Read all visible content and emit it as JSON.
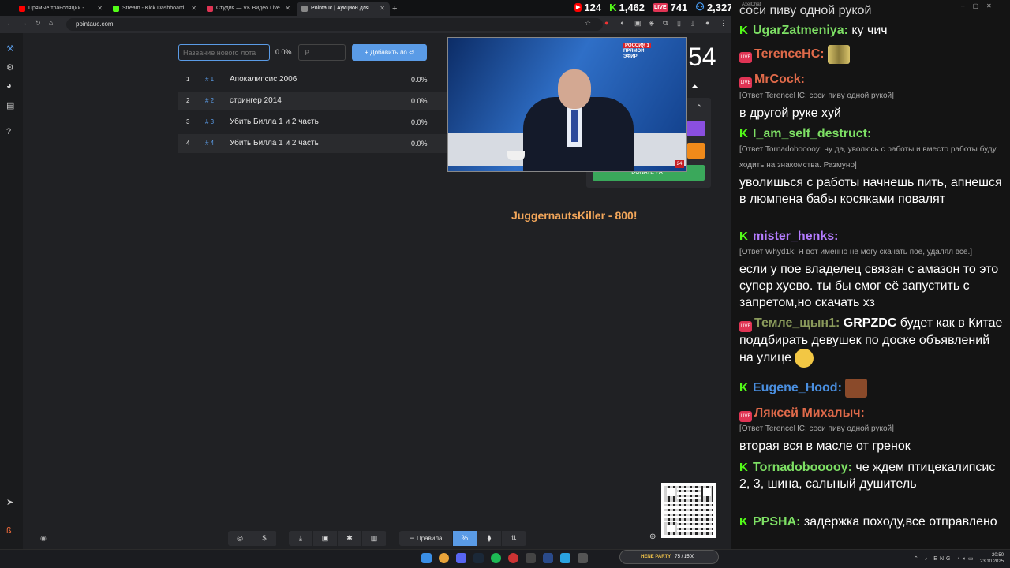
{
  "browser": {
    "tabs": [
      {
        "title": "Прямые трансляции - YouTube",
        "color": "#ff0000"
      },
      {
        "title": "Stream - Kick Dashboard",
        "color": "#53fc18"
      },
      {
        "title": "Студия — VK Видео Live",
        "color": "#e03454"
      },
      {
        "title": "Pointauc | Аукцион для стрим...",
        "color": "#888888"
      }
    ],
    "new_tab": "+",
    "url": "pointauc.com"
  },
  "stream_stats": {
    "youtube": "124",
    "kick": "1,462",
    "vk": "741",
    "total": "2,327",
    "vk_badge": "LIVE"
  },
  "auction": {
    "lot_placeholder": "Название нового лота",
    "percent": "0.0%",
    "amount_placeholder": "₽",
    "add_button": "Добавить ло",
    "lots": [
      {
        "num": "1",
        "hash": "# 1",
        "name": "Апокалипсис 2006",
        "pct": "0.0%"
      },
      {
        "num": "2",
        "hash": "# 2",
        "name": "стрингер 2014",
        "pct": "0.0%"
      },
      {
        "num": "3",
        "hash": "# 3",
        "name": "Убить Билла 1 и 2 часть",
        "pct": "0.0%"
      },
      {
        "num": "4",
        "hash": "# 4",
        "name": "Убить Билла 1 и 2 часть",
        "pct": "0.0%"
      }
    ],
    "timer_fragment": "54",
    "donate_pay": "DONATE PAY",
    "winner_text": "JuggernautsKiller - 800!",
    "bottom_rules": "Правила",
    "bottom_percent": "%"
  },
  "video": {
    "channel_logo": "РОССИЯ 1",
    "live_text": "ПРЯМОЙ ЭФИР",
    "badge": "24"
  },
  "chat": {
    "window_title": "AxelChat",
    "messages": [
      {
        "platform": "kick",
        "user": "UgarZatmeniya:",
        "color": "#7ddf64",
        "text": "ку чич"
      },
      {
        "platform": "vk",
        "user": "TerenceHC:",
        "color": "#e06a4a",
        "text": ""
      },
      {
        "platform": "vk",
        "user": "MrCock:",
        "color": "#e06a4a",
        "reply": "[Ответ TerenceHC: соси пиву одной рукой]",
        "text": "в другой руке хуй"
      },
      {
        "platform": "kick",
        "user": "I_am_self_destruct:",
        "color": "#7ddf64",
        "reply": "[Ответ Tornadobooooy: ну да, уволюсь с работы и вместо работы буду ходить на знакомства. Размуно]",
        "text": "уволишься с работы начнешь пить, апнешся в люмпена бабы косяками повалят"
      },
      {
        "platform": "kick",
        "user": "mister_henks:",
        "color": "#b47cff",
        "reply": "[Ответ Whyd1k: Я вот именно не могу скачать пое, удалял всё.]",
        "text": "если у пое владелец связан с амазон то это супер хуево. ты бы смог её запустить с запретом,но скачать хз"
      },
      {
        "platform": "vk",
        "user": "Темле_щын1:",
        "color": "#8a9a5b",
        "bold": "GRPZDC",
        "text": "будет как в Китае поддбирать девушек по доске объявлений на улице"
      },
      {
        "platform": "kick",
        "user": "Eugene_Hood:",
        "color": "#4a8fe0",
        "text": ""
      },
      {
        "platform": "vk",
        "user": "Ляксей Михалыч:",
        "color": "#e06a4a",
        "reply": "[Ответ TerenceHC: соси пиву одной рукой]",
        "text": "вторая вся в масле от гренок"
      },
      {
        "platform": "kick",
        "user": "Tornadobooooy:",
        "color": "#7ddf64",
        "text": "че ждем птицекалипсис 2, 3, шина, сальный душитель"
      },
      {
        "platform": "kick",
        "user": "PPSHA:",
        "color": "#7ddf64",
        "text": "задержка походу,все отправлено"
      }
    ],
    "top_cut": "соси пиву одной рукой"
  },
  "taskbar": {
    "hene_name": "HENE PARTY",
    "hene_count": "75 / 1500",
    "lang": "ENG",
    "time": "20:50",
    "date": "23.10.2025"
  }
}
